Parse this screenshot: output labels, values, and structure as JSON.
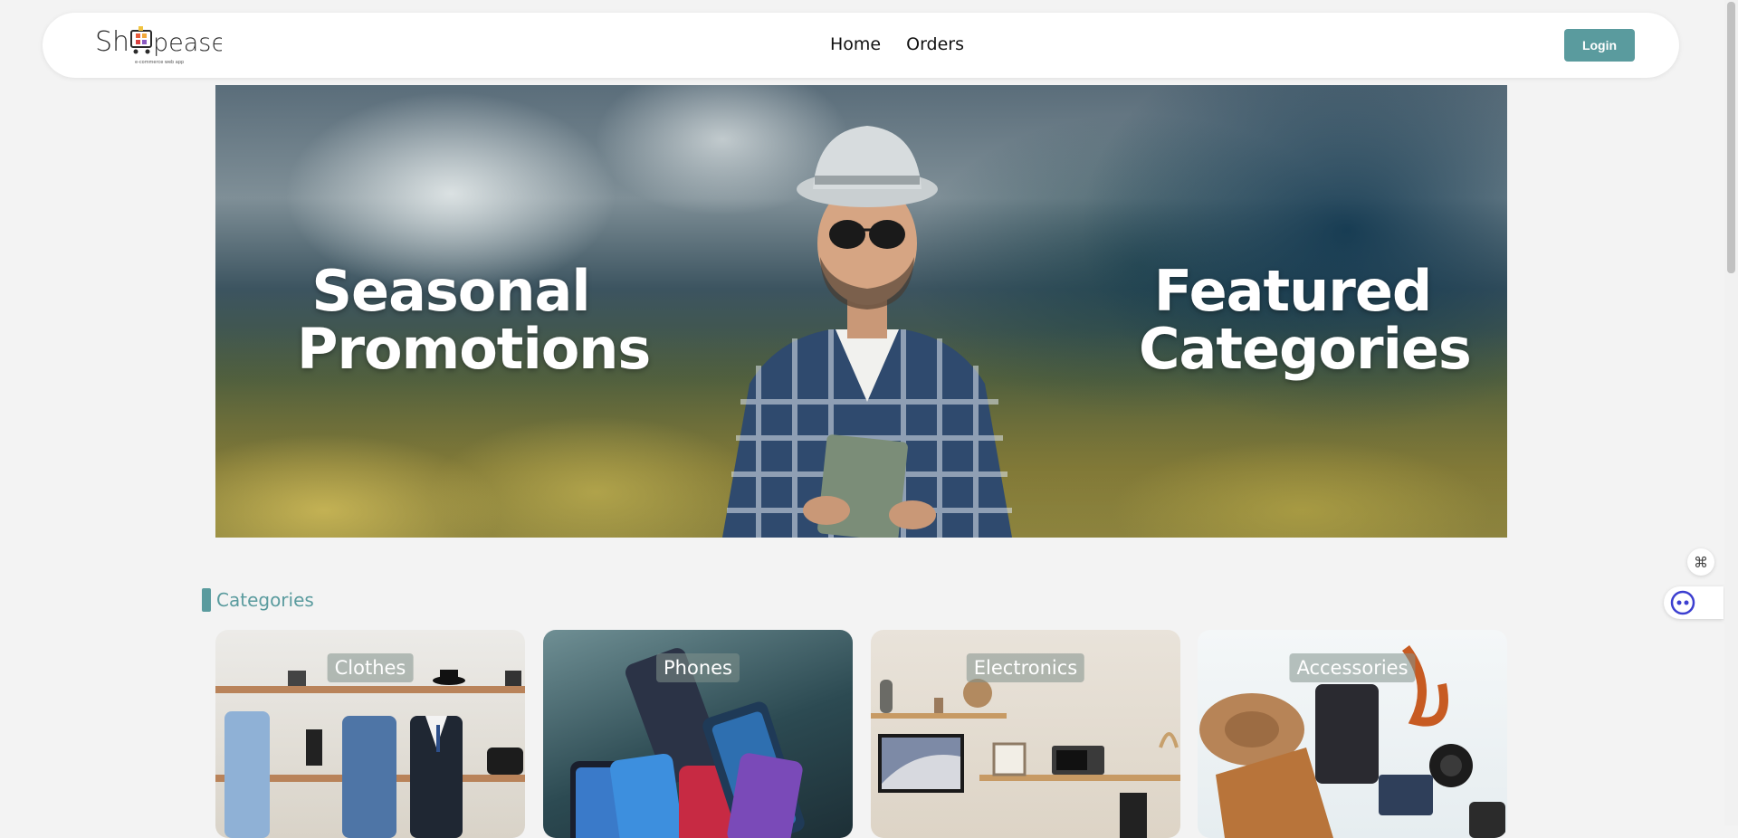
{
  "navbar": {
    "logo_text": "Shopease",
    "logo_tagline": "e-commerce web app",
    "links": [
      "Home",
      "Orders"
    ],
    "login_label": "Login"
  },
  "hero": {
    "left_title": "Seasonal Promotions",
    "right_title": "Featured Categories"
  },
  "categories": {
    "heading": "Categories",
    "items": [
      {
        "label": "Clothes"
      },
      {
        "label": "Phones"
      },
      {
        "label": "Electronics"
      },
      {
        "label": "Accessories"
      }
    ]
  },
  "colors": {
    "accent": "#5a9b9e",
    "page_background": "#f3f3f3"
  },
  "icons": {
    "widget_top": "command-icon",
    "widget_bottom": "assistant-bot-icon"
  }
}
